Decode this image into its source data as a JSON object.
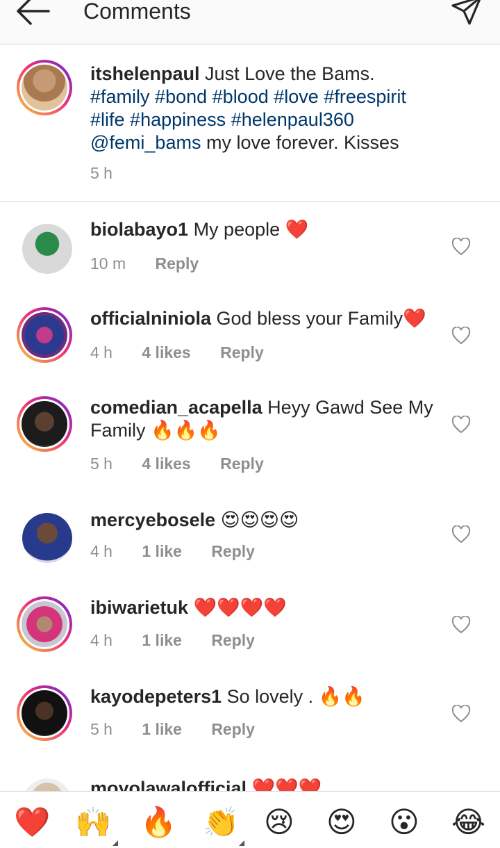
{
  "header": {
    "title": "Comments"
  },
  "caption": {
    "username": "itshelenpaul",
    "text_lead": "Just Love the Bams.",
    "hashtags": [
      "#family",
      "#bond",
      "#blood",
      "#love",
      "#freespirit",
      "#life",
      "#happiness",
      "#helenpaul360"
    ],
    "mention": "@femi_bams",
    "text_tail": "my love forever.  Kisses",
    "time": "5 h"
  },
  "comments": [
    {
      "username": "biolabayo1",
      "text": "My people ❤️",
      "time": "10 m",
      "likes": "",
      "reply": "Reply",
      "ring": false
    },
    {
      "username": "officialniniola",
      "text": "God bless your Family❤️",
      "time": "4 h",
      "likes": "4 likes",
      "reply": "Reply",
      "ring": true
    },
    {
      "username": "comedian_acapella",
      "text": "Heyy Gawd See My Family 🔥🔥🔥",
      "time": "5 h",
      "likes": "4 likes",
      "reply": "Reply",
      "ring": true
    },
    {
      "username": "mercyebosele",
      "text": "😍😍😍😍",
      "time": "4 h",
      "likes": "1 like",
      "reply": "Reply",
      "ring": false
    },
    {
      "username": "ibiwarietuk",
      "text": "❤️❤️❤️❤️",
      "time": "4 h",
      "likes": "1 like",
      "reply": "Reply",
      "ring": true
    },
    {
      "username": "kayodepeters1",
      "text": "So lovely . 🔥🔥",
      "time": "5 h",
      "likes": "1 like",
      "reply": "Reply",
      "ring": true
    },
    {
      "username": "moyolawalofficial",
      "text": "❤️❤️❤️",
      "time": "",
      "likes": "",
      "reply": "",
      "ring": false
    }
  ],
  "quick_reactions": [
    "❤️",
    "🙌",
    "🔥",
    "👏",
    "😢",
    "😍",
    "😮",
    "😂"
  ],
  "colors": {
    "hashtag": "#00376b",
    "meta": "#8e8e8e",
    "divider": "#dbdbdb"
  }
}
